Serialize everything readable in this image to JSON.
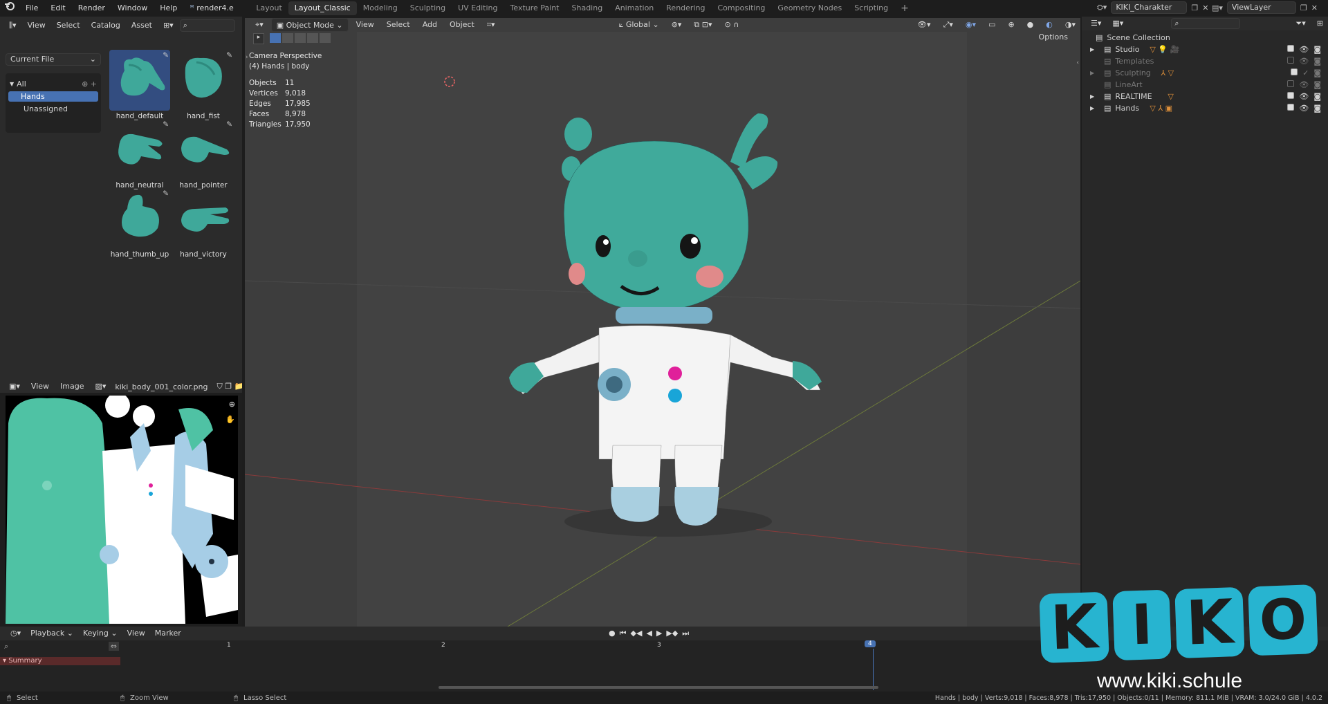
{
  "menubar": {
    "items": [
      "File",
      "Edit",
      "Render",
      "Window",
      "Help"
    ],
    "render_tab": "render4.e",
    "workspaces": [
      "Layout",
      "Layout_Classic",
      "Modeling",
      "Sculpting",
      "UV Editing",
      "Texture Paint",
      "Shading",
      "Animation",
      "Rendering",
      "Compositing",
      "Geometry Nodes",
      "Scripting"
    ],
    "active_workspace": "Layout_Classic",
    "scene_name": "KIKI_Charakter",
    "view_layer": "ViewLayer"
  },
  "asset_browser": {
    "menus": [
      "View",
      "Select",
      "Catalog",
      "Asset"
    ],
    "library": "Current File",
    "catalog_root": "All",
    "catalogs": [
      "Hands",
      "Unassigned"
    ],
    "assets": [
      "hand_default",
      "hand_fist",
      "hand_neutral",
      "hand_pointer",
      "hand_thumb_up",
      "hand_victory"
    ],
    "selected_asset": "hand_default"
  },
  "image_editor": {
    "menus": [
      "View",
      "Image"
    ],
    "image_name": "kiki_body_001_color.png"
  },
  "viewport": {
    "mode": "Object Mode",
    "menus": [
      "View",
      "Select",
      "Add",
      "Object"
    ],
    "orientation": "Global",
    "options_label": "Options",
    "overlay_title": "Camera Perspective",
    "overlay_subtitle": "(4) Hands | body",
    "stats": [
      {
        "label": "Objects",
        "value": "11"
      },
      {
        "label": "Vertices",
        "value": "9,018"
      },
      {
        "label": "Edges",
        "value": "17,985"
      },
      {
        "label": "Faces",
        "value": "8,978"
      },
      {
        "label": "Triangles",
        "value": "17,950"
      }
    ]
  },
  "outliner": {
    "root": "Scene Collection",
    "collections": [
      {
        "name": "Studio",
        "enabled": true,
        "expandable": true
      },
      {
        "name": "Templates",
        "enabled": false,
        "expandable": false
      },
      {
        "name": "Sculpting",
        "enabled": true,
        "expandable": true
      },
      {
        "name": "LineArt",
        "enabled": false,
        "expandable": false
      },
      {
        "name": "REALTIME",
        "enabled": true,
        "expandable": true
      },
      {
        "name": "Hands",
        "enabled": true,
        "expandable": true
      }
    ]
  },
  "timeline": {
    "menus": [
      "Playback",
      "Keying",
      "View",
      "Marker"
    ],
    "frames": [
      "1",
      "2",
      "3",
      "4"
    ],
    "current_frame": "4",
    "summary_label": "Summary"
  },
  "statusbar": {
    "hints": [
      "Select",
      "Zoom View",
      "Lasso Select"
    ],
    "info": "Hands | body | Verts:9,018 | Faces:8,978 | Tris:17,950 | Objects:0/11 | Memory: 811.1 MiB | VRAM: 3.0/24.0 GiB | 4.0.2"
  },
  "watermark": {
    "logo_text": "KIKO",
    "url": "www.kiki.schule"
  },
  "colors": {
    "accent": "#4772b3",
    "character_teal": "#3fa89a",
    "logo_blue": "#27b4d0"
  }
}
